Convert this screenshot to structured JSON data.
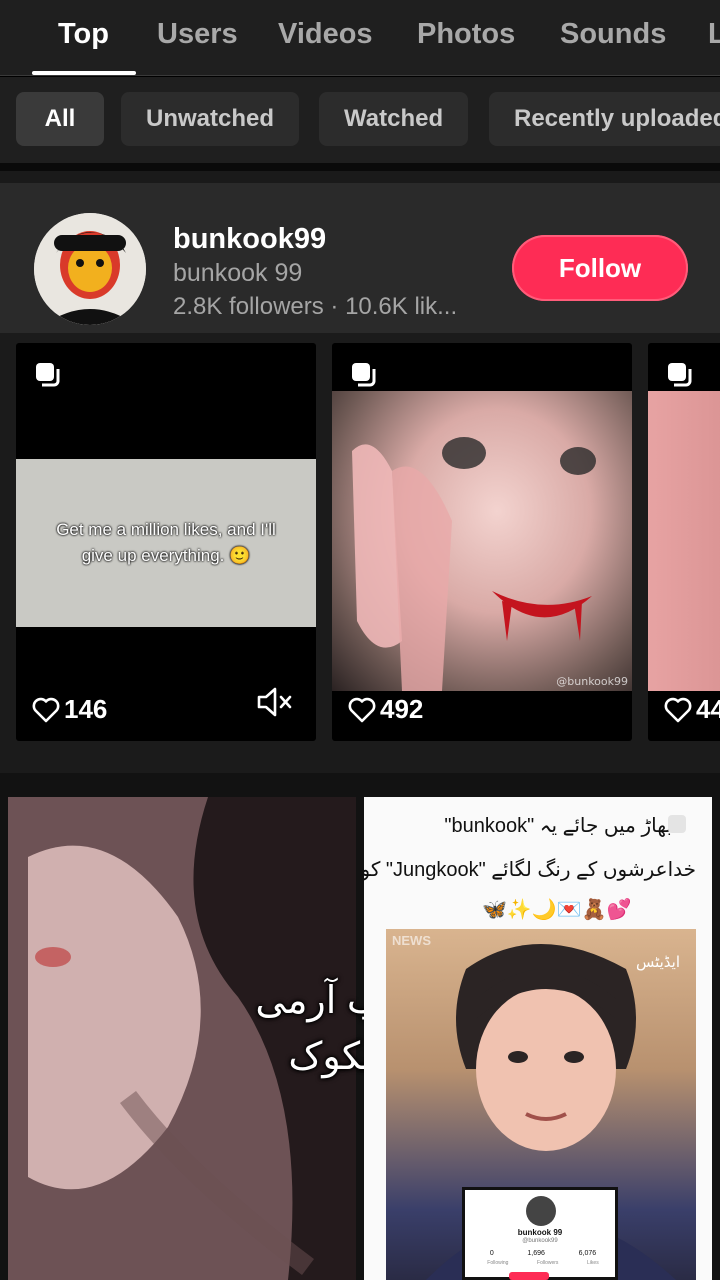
{
  "tabs": [
    "Top",
    "Users",
    "Videos",
    "Photos",
    "Sounds",
    "L"
  ],
  "filters": [
    "All",
    "Unwatched",
    "Watched",
    "Recently uploaded"
  ],
  "user": {
    "username": "bunkook99",
    "nickname": "bunkook 99",
    "stats": "2.8K followers · 10.6K lik...",
    "follow_label": "Follow"
  },
  "videos": [
    {
      "likes": "146",
      "caption": "Get me a million likes, and I'll give up everything. 🙂"
    },
    {
      "likes": "492",
      "watermark": "@bunkook99"
    },
    {
      "likes": "44"
    }
  ],
  "bottom": {
    "left_overlay_line1": "کیا مطلب آرمی",
    "left_overlay_line2": "اب ہم بنکوک",
    "right_line1": "بھاڑ میں جائے یہ \"bunkook\"",
    "right_line2": "خداعرشوں کے رنگ لگائے \"Jungkook\" کو",
    "right_emojis": "🦋✨🌙💌🧸💕",
    "right_news": "NEWS",
    "right_edits": "ایڈیٹس",
    "mini_profile_name": "bunkook 99",
    "mini_profile_handle": "@bunkook99",
    "mini_stats": [
      "0",
      "1,696",
      "6,076"
    ],
    "mini_stat_labels": [
      "Following",
      "Followers",
      "Likes"
    ]
  },
  "colors": {
    "accent": "#fe2c55",
    "background": "#1f1f1f"
  }
}
